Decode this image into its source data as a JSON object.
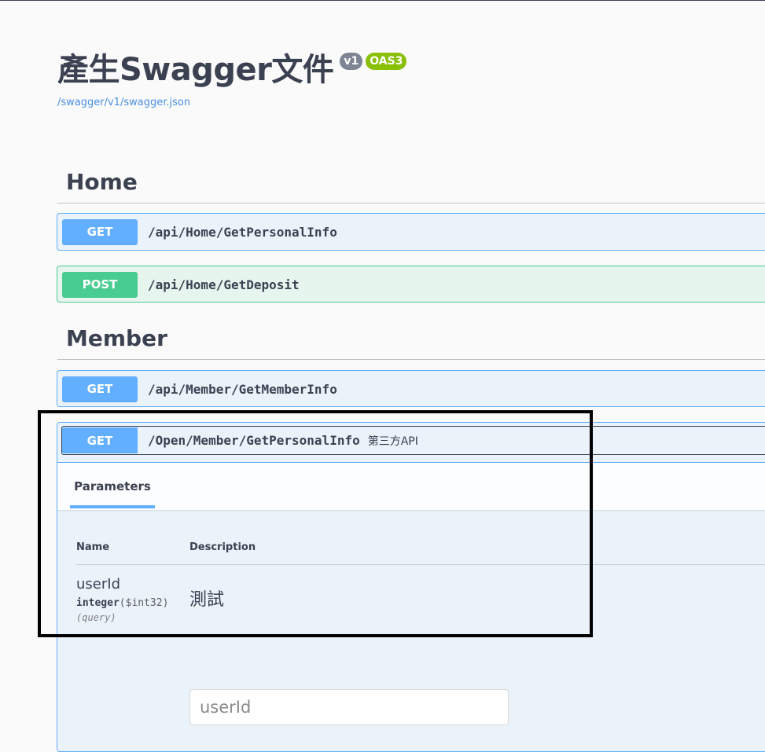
{
  "info": {
    "title": "產生Swagger文件",
    "version_badge": "v1",
    "spec_badge": "OAS3",
    "spec_url": "/swagger/v1/swagger.json"
  },
  "colors": {
    "get": "#61affe",
    "post": "#49cc90",
    "text": "#3b4151",
    "link": "#4990e2",
    "badge_version": "#7d8492",
    "badge_spec": "#89bf04"
  },
  "tags": [
    {
      "name": "Home",
      "operations": [
        {
          "method": "GET",
          "path": "/api/Home/GetPersonalInfo"
        },
        {
          "method": "POST",
          "path": "/api/Home/GetDeposit"
        }
      ]
    },
    {
      "name": "Member",
      "operations": [
        {
          "method": "GET",
          "path": "/api/Member/GetMemberInfo"
        },
        {
          "method": "GET",
          "path": "/Open/Member/GetPersonalInfo",
          "summary": "第三方API",
          "expanded": true,
          "tab": "Parameters",
          "param_headers": {
            "name": "Name",
            "description": "Description"
          },
          "parameters": [
            {
              "name": "userId",
              "type": "integer",
              "format": "($int32)",
              "in": "(query)",
              "description": "測試",
              "placeholder": "userId"
            }
          ]
        }
      ]
    }
  ]
}
